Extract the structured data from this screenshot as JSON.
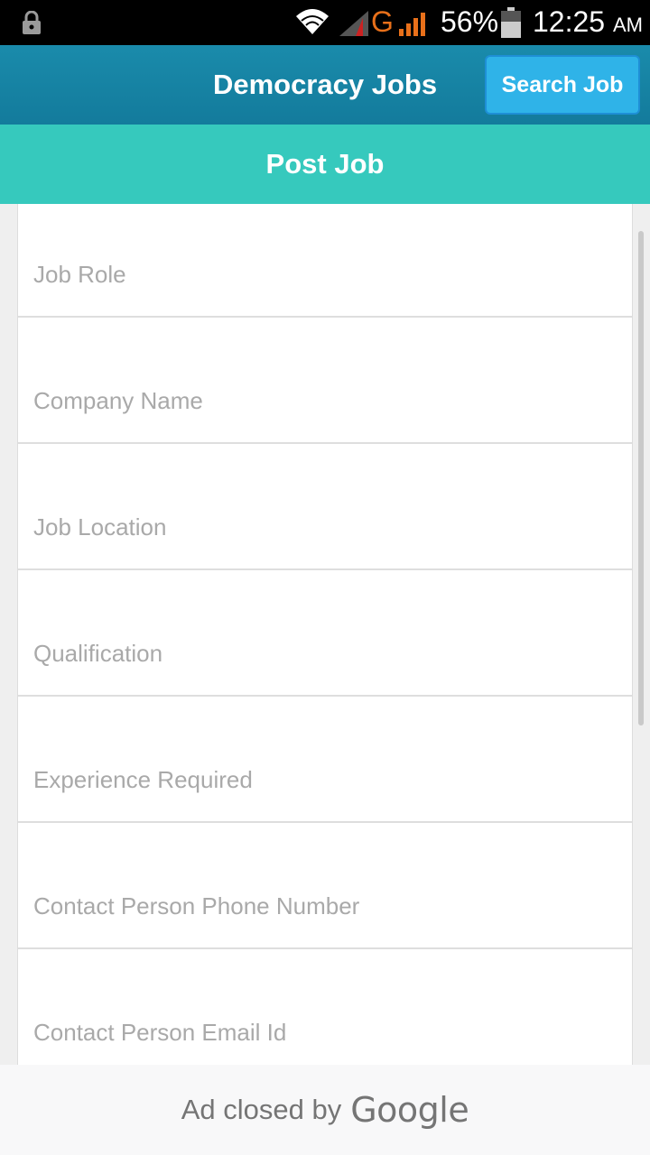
{
  "status_bar": {
    "network": "G",
    "battery_percent": "56%",
    "time": "12:25",
    "ampm": "AM",
    "icons": [
      "lock-icon",
      "wifi-icon",
      "signal-icon",
      "signal-icon",
      "battery-icon"
    ]
  },
  "app_bar": {
    "title": "Democracy Jobs",
    "search_button": "Search Job",
    "color": "#1a8bab"
  },
  "section": {
    "title": "Post Job",
    "color": "#36c9bd"
  },
  "form": {
    "fields": [
      {
        "placeholder": "Job Role",
        "value": ""
      },
      {
        "placeholder": "Company Name",
        "value": ""
      },
      {
        "placeholder": "Job Location",
        "value": ""
      },
      {
        "placeholder": "Qualification",
        "value": ""
      },
      {
        "placeholder": "Experience Required",
        "value": ""
      },
      {
        "placeholder": "Contact Person Phone Number",
        "value": ""
      },
      {
        "placeholder": "Contact Person Email Id",
        "value": ""
      }
    ]
  },
  "ad": {
    "text": "Ad closed by",
    "brand": "Google"
  }
}
